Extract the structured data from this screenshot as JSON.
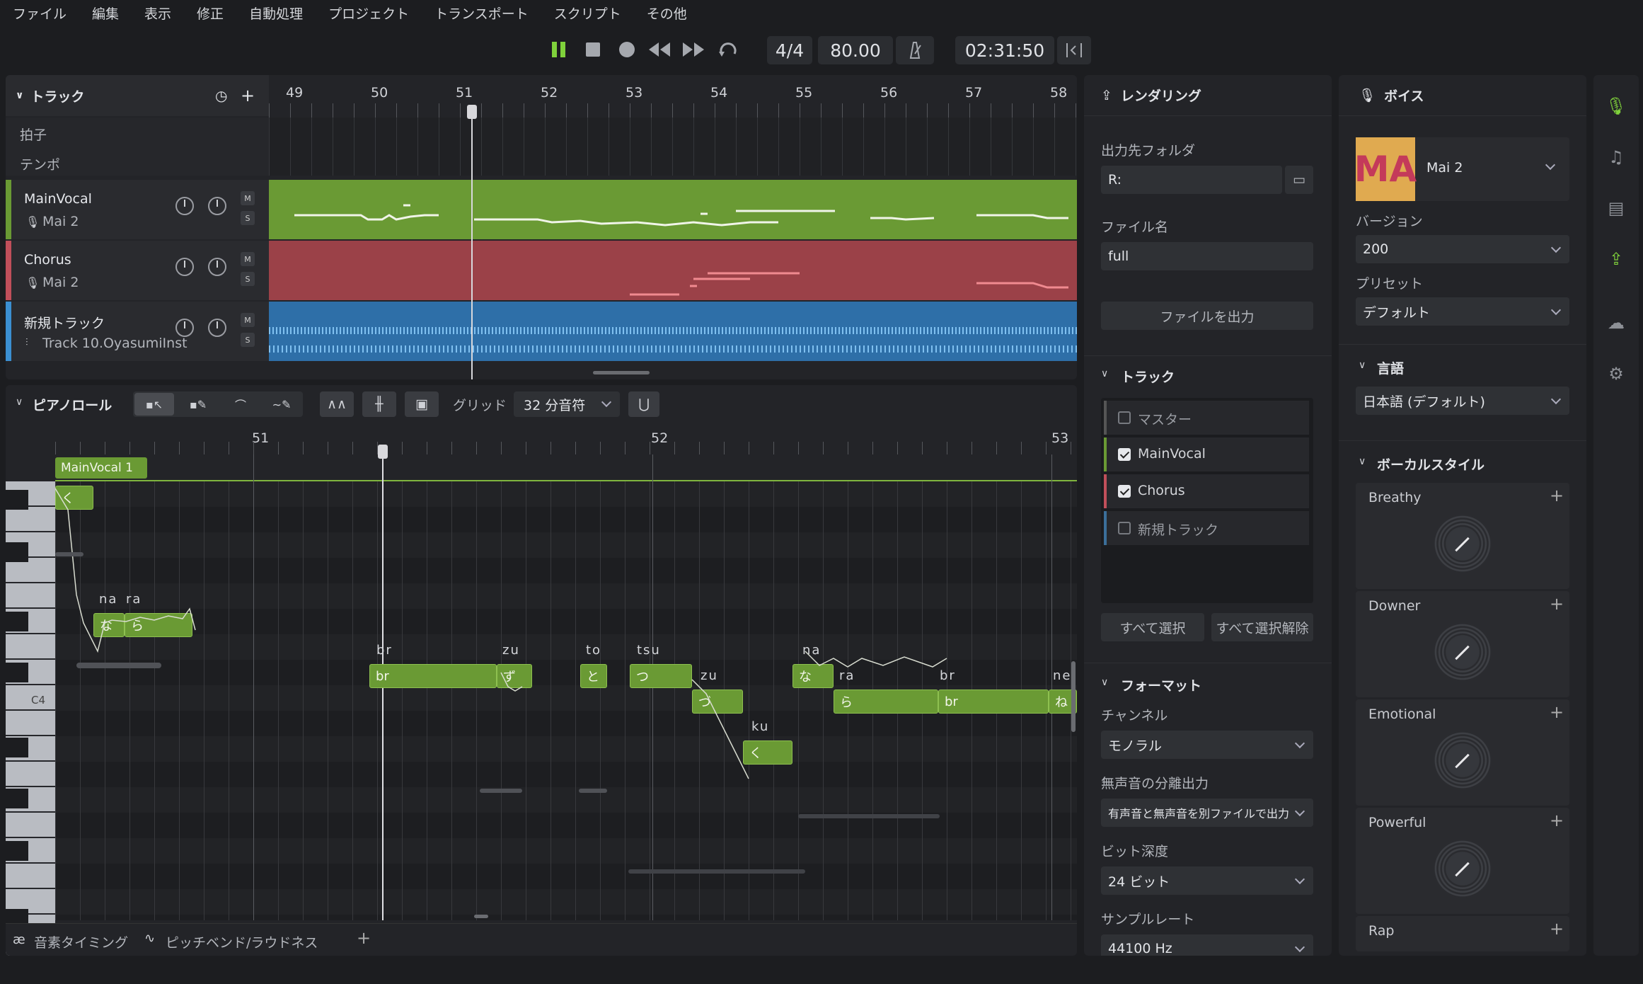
{
  "menu": [
    "ファイル",
    "編集",
    "表示",
    "修正",
    "自動処理",
    "プロジェクト",
    "トランスポート",
    "スクリプト",
    "その他"
  ],
  "transport": {
    "time_signature": "4/4",
    "tempo": "80.00",
    "time": "02:31:50"
  },
  "tracks_panel": {
    "title": "トラック",
    "ruler": [
      "49",
      "50",
      "51",
      "52",
      "53",
      "54",
      "55",
      "56",
      "57",
      "58"
    ],
    "rows": {
      "beat": "拍子",
      "tempo": "テンポ"
    },
    "tracks": [
      {
        "name": "MainVocal",
        "sub": "Mai 2",
        "color": "#6a9a34"
      },
      {
        "name": "Chorus",
        "sub": "Mai 2",
        "color": "#c04f5a"
      },
      {
        "name": "新規トラック",
        "sub": "Track 10.OyasumiInst",
        "color": "#3b8fd1"
      }
    ],
    "m": "M",
    "s": "S"
  },
  "piano": {
    "title": "ピアノロール",
    "grid_label": "グリッド",
    "grid_value": "32 分音符",
    "ruler": [
      "51",
      "52",
      "53"
    ],
    "clip": "MainVocal 1",
    "c4": "C4",
    "notes": [
      {
        "lyric": "く",
        "ph": ""
      },
      {
        "lyric": "な",
        "ph": "na"
      },
      {
        "lyric": "ら",
        "ph": "ra"
      },
      {
        "lyric": "br",
        "ph": "br"
      },
      {
        "lyric": "ず",
        "ph": "zu"
      },
      {
        "lyric": "と",
        "ph": "to"
      },
      {
        "lyric": "つ",
        "ph": "tsu"
      },
      {
        "lyric": "づ",
        "ph": "zu"
      },
      {
        "lyric": "く",
        "ph": "ku"
      },
      {
        "lyric": "な",
        "ph": "na"
      },
      {
        "lyric": "ら",
        "ph": "ra"
      },
      {
        "lyric": "br",
        "ph": "br"
      },
      {
        "lyric": "ね",
        "ph": "ne"
      }
    ],
    "bottom_tabs": [
      "音素タイミング",
      "ピッチベンド/ラウドネス"
    ]
  },
  "render": {
    "title": "レンダリング",
    "out_folder_label": "出力先フォルダ",
    "out_folder": "R:",
    "file_name_label": "ファイル名",
    "file_name": "full",
    "export_button": "ファイルを出力",
    "track_title": "トラック",
    "track_items": [
      {
        "name": "マスター",
        "checked": false,
        "color": "#555"
      },
      {
        "name": "MainVocal",
        "checked": true,
        "color": "#6a9a34"
      },
      {
        "name": "Chorus",
        "checked": true,
        "color": "#c04f5a"
      },
      {
        "name": "新規トラック",
        "checked": false,
        "color": "#3b6f9a"
      }
    ],
    "select_all": "すべて選択",
    "deselect_all": "すべて選択解除",
    "format_title": "フォーマット",
    "channel_label": "チャンネル",
    "channel": "モノラル",
    "silence_label": "無声音の分離出力",
    "silence": "有声音と無声音を別ファイルで出力",
    "bit_label": "ビット深度",
    "bit": "24 ビット",
    "rate_label": "サンプルレート",
    "rate": "44100 Hz"
  },
  "voice": {
    "title": "ボイス",
    "logo": "MA",
    "name": "Mai 2",
    "version_label": "バージョン",
    "version": "200",
    "preset_label": "プリセット",
    "preset": "デフォルト",
    "lang_title": "言語",
    "lang": "日本語 (デフォルト)",
    "style_title": "ボーカルスタイル",
    "styles": [
      "Breathy",
      "Downer",
      "Emotional",
      "Powerful",
      "Rap"
    ]
  }
}
